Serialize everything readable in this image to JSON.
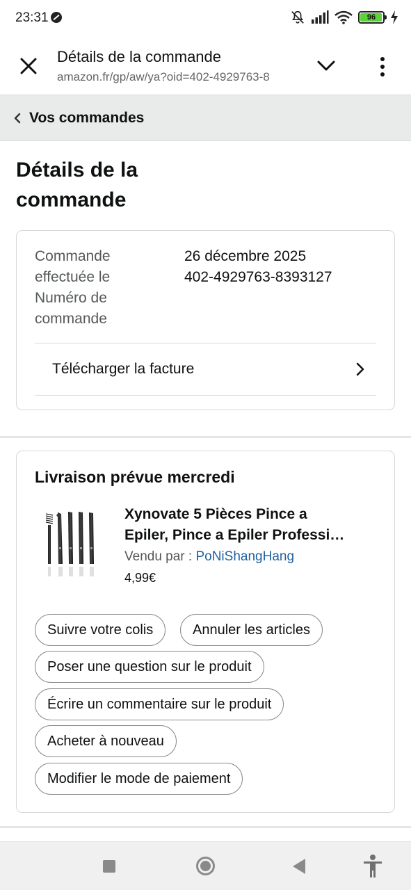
{
  "status_bar": {
    "time": "23:31",
    "battery_level": "96",
    "battery_color": "#5bd13a",
    "icons": [
      "do-not-disturb-icon",
      "bell-muted-icon",
      "signal-icon",
      "wifi-icon",
      "battery-icon",
      "charging-icon"
    ]
  },
  "browser": {
    "title": "Détails de la commande",
    "url": "amazon.fr/gp/aw/ya?oid=402-4929763-8",
    "icons": [
      "close-icon",
      "chevron-down-icon",
      "more-vert-icon"
    ]
  },
  "breadcrumb": {
    "label": "Vos commandes"
  },
  "page": {
    "title_line1": "Détails de la",
    "title_line2": "commande"
  },
  "order_summary": {
    "label_line1": "Commande",
    "label_line2": "effectuée le",
    "label_line3": "Numéro de",
    "label_line4": "commande",
    "order_date": "26 décembre 2025",
    "order_number": "402-4929763-8393127",
    "download_invoice": "Télécharger la facture"
  },
  "delivery": {
    "title": "Livraison prévue mercredi",
    "product": {
      "name_line1": "Xynovate 5 Pièces Pince a",
      "name_line2": "Epiler, Pince a Epiler Professi…",
      "sold_by_label": "Vendu par : ",
      "seller": "PoNiShangHang",
      "price": "4,99€"
    },
    "actions": {
      "track": "Suivre votre colis",
      "cancel": "Annuler les articles",
      "ask_question": "Poser une question sur le produit",
      "write_review": "Écrire un commentaire sur le produit",
      "buy_again": "Acheter à nouveau",
      "change_payment": "Modifier le mode de paiement"
    }
  },
  "colors": {
    "link": "#2162a1",
    "breadcrumb_bg": "#e9ebeb",
    "border": "#d5d9d9"
  }
}
